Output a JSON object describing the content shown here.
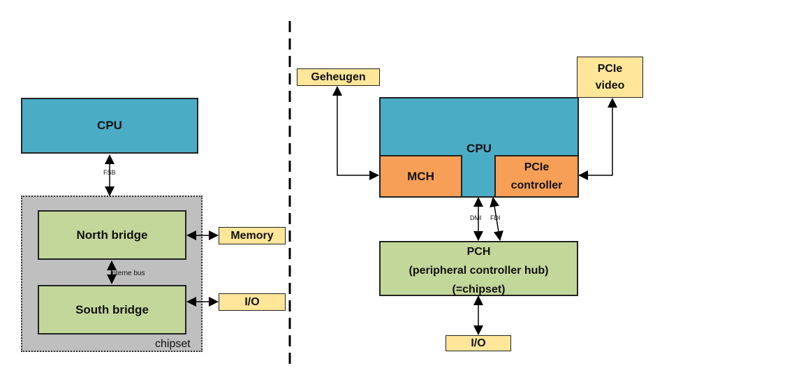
{
  "left": {
    "cpu": "CPU",
    "fsb": "FSB",
    "north_bridge": "North bridge",
    "interne_bus": "interne bus",
    "south_bridge": "South bridge",
    "chipset": "chipset",
    "memory": "Memory",
    "io": "I/O"
  },
  "right": {
    "geheugen": "Geheugen",
    "pcie_video_1": "PCIe",
    "pcie_video_2": "video",
    "cpu": "CPU",
    "mch": "MCH",
    "pcie_ctrl_1": "PCIe",
    "pcie_ctrl_2": "controller",
    "dmi": "DMI",
    "fdi": "FDI",
    "pch_1": "PCH",
    "pch_2": "(peripheral controller hub)",
    "pch_3": "(=chipset)",
    "io": "I/O"
  },
  "colors": {
    "cpu": "#4bacc6",
    "bridge": "#c4d79b",
    "peripheral": "#ffe699",
    "controller": "#f79f56",
    "chipset": "#bfbfbf"
  }
}
